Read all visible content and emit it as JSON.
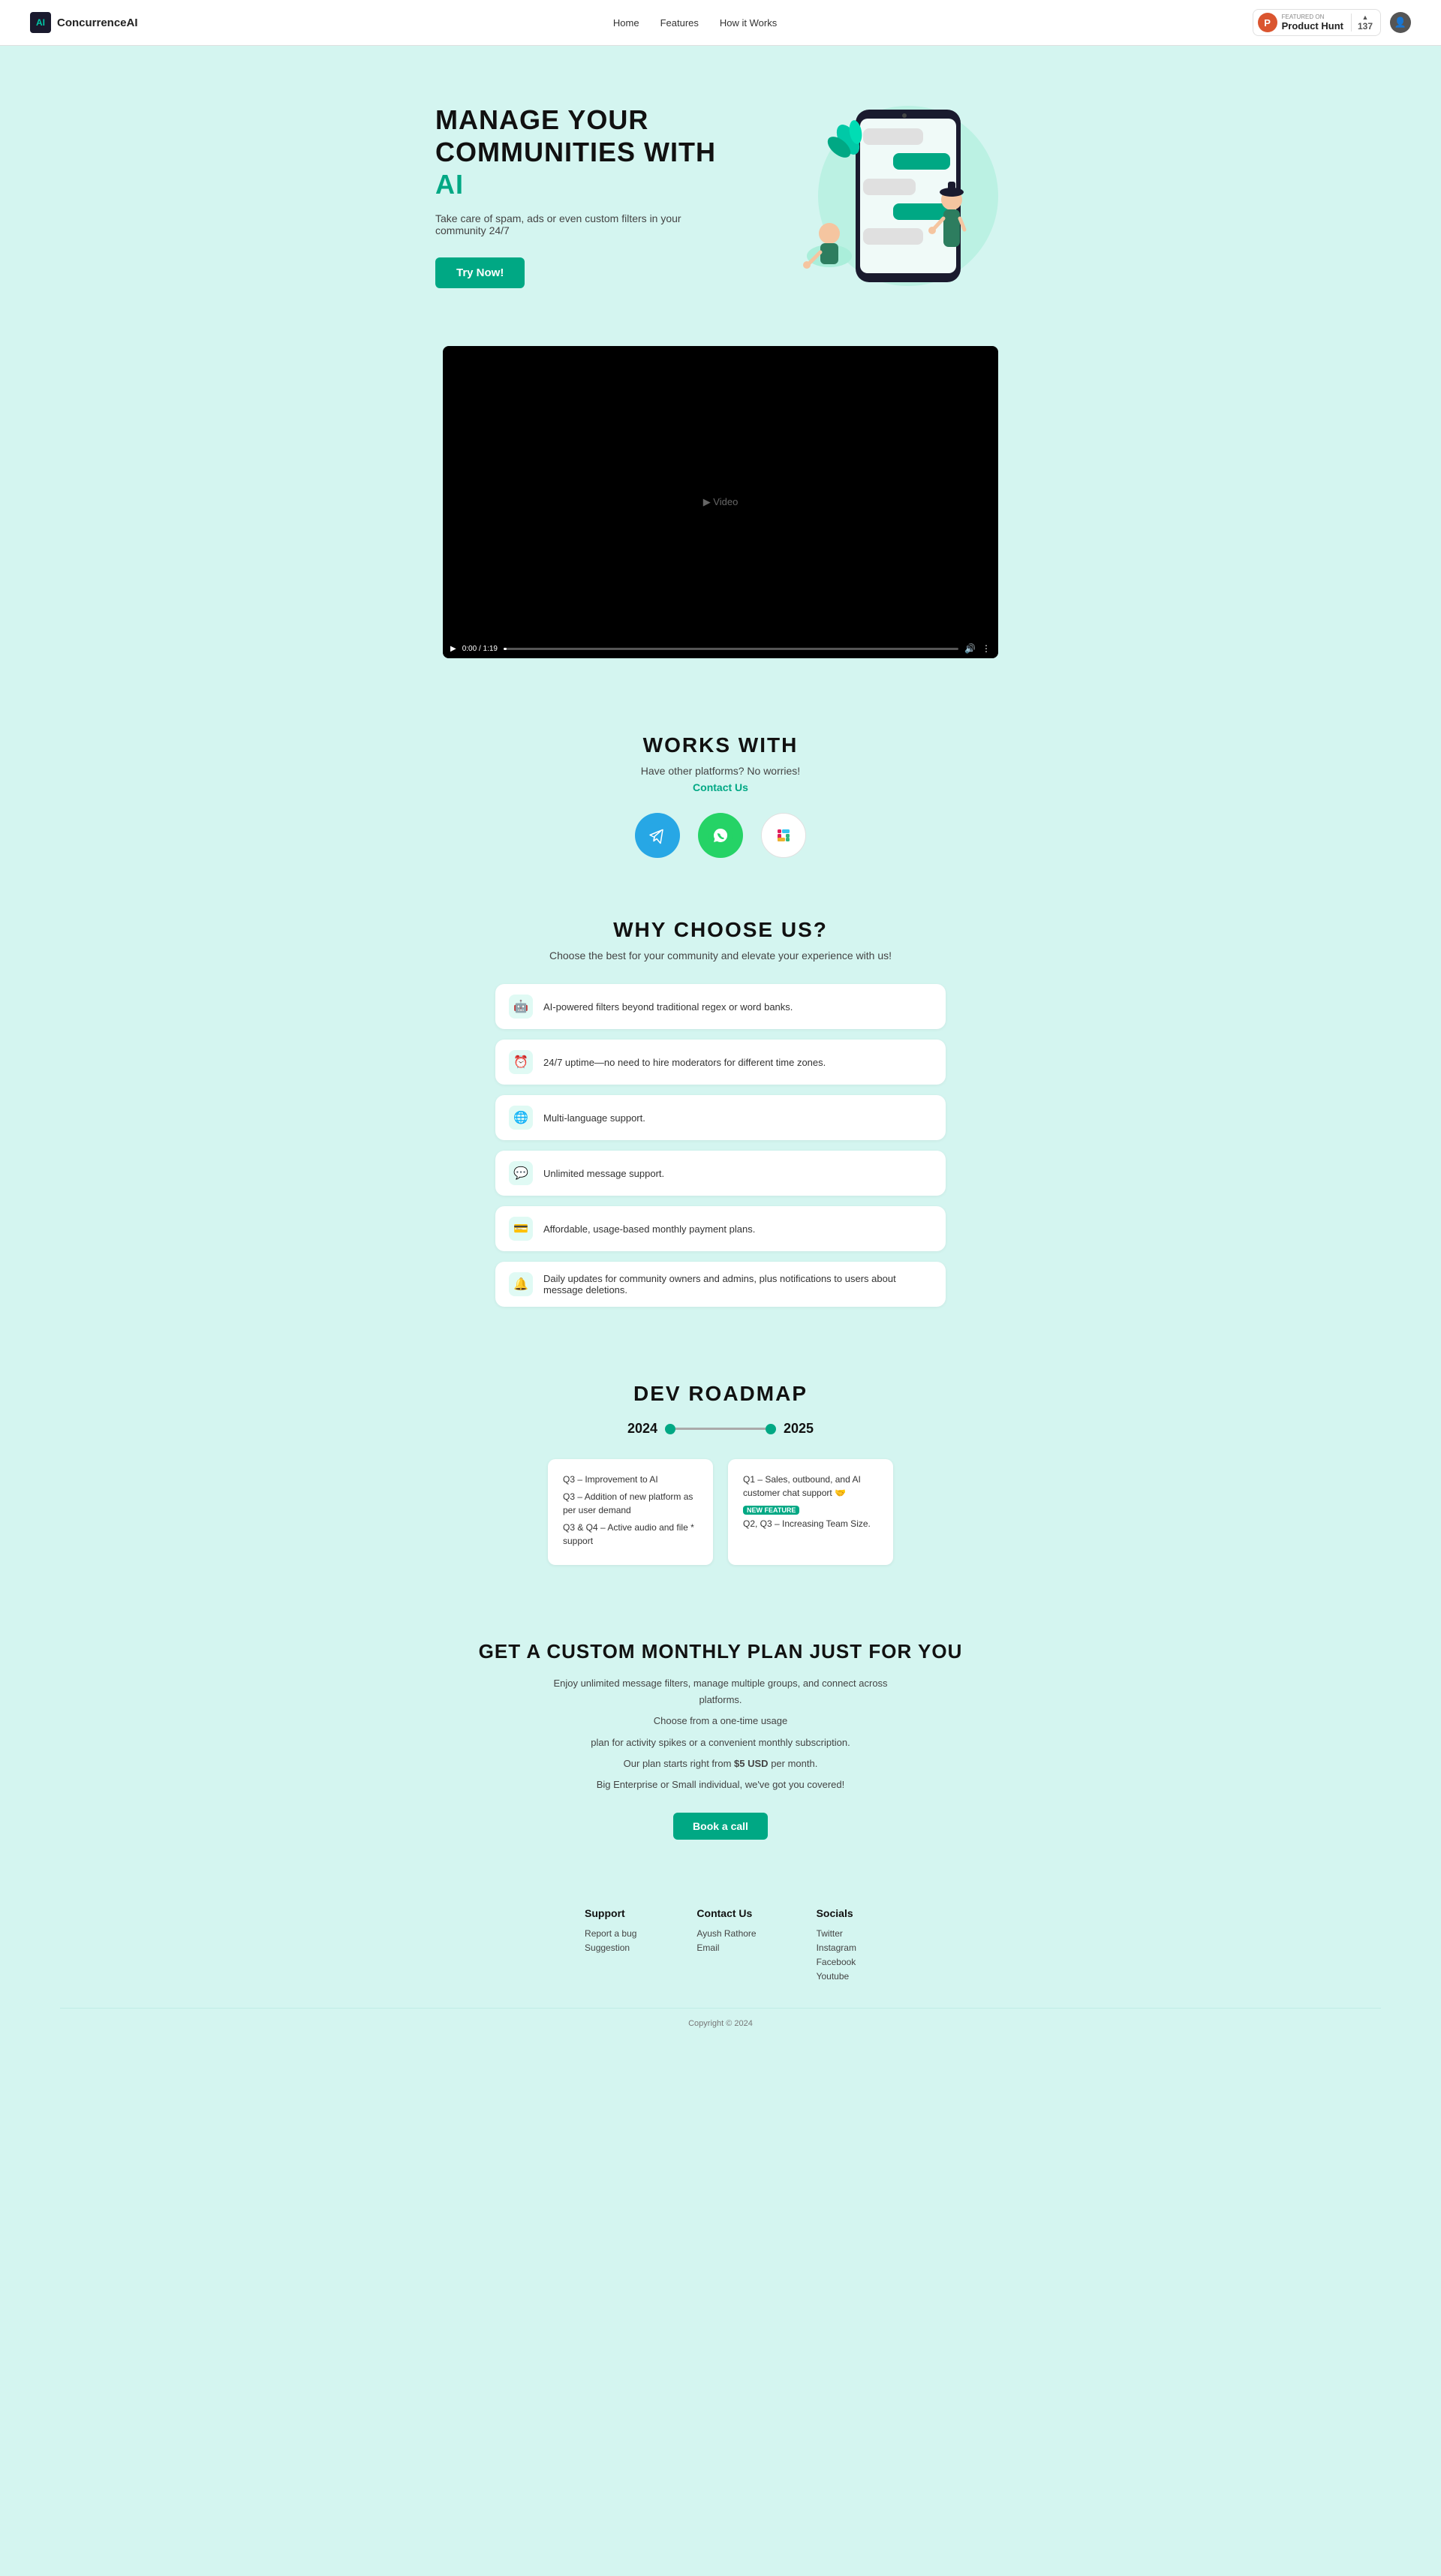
{
  "brand": {
    "logo_text": "ConcurrenceAI",
    "logo_icon": "AI"
  },
  "nav": {
    "links": [
      "Home",
      "Features",
      "How it Works"
    ],
    "product_hunt": {
      "featured_label": "FEATURED ON",
      "name": "Product Hunt",
      "count": "137",
      "arrow": "▲"
    }
  },
  "hero": {
    "title_line1": "MANAGE YOUR COMMUNITIES WITH",
    "title_ai": "AI",
    "subtitle": "Take care of spam, ads or even custom filters in your community 24/7",
    "cta": "Try Now!"
  },
  "video": {
    "time": "0:00 / 1:19"
  },
  "works_with": {
    "title": "WORKS WITH",
    "subtitle": "Have other platforms? No worries!",
    "contact_label": "Contact Us",
    "platforms": [
      {
        "name": "Telegram",
        "icon": "✈",
        "bg": "telegram"
      },
      {
        "name": "WhatsApp",
        "icon": "📱",
        "bg": "whatsapp"
      },
      {
        "name": "Slack",
        "icon": "◈",
        "bg": "slack"
      }
    ]
  },
  "why_choose": {
    "title": "WHY CHOOSE US?",
    "subtitle": "Choose the best for your community and elevate your experience with us!",
    "features": [
      {
        "icon": "🤖",
        "text": "AI-powered filters beyond traditional regex or word banks."
      },
      {
        "icon": "⏰",
        "text": "24/7 uptime—no need to hire moderators for different time zones."
      },
      {
        "icon": "🌐",
        "text": "Multi-language support."
      },
      {
        "icon": "💬",
        "text": "Unlimited message support."
      },
      {
        "icon": "💳",
        "text": "Affordable, usage-based monthly payment plans."
      },
      {
        "icon": "🔔",
        "text": "Daily updates for community owners and admins, plus notifications to users about message deletions."
      }
    ]
  },
  "dev_roadmap": {
    "title": "DEV ROADMAP",
    "year_left": "2024",
    "year_right": "2025",
    "cards": [
      {
        "items": [
          "Q3 – Improvement to AI",
          "Q3 – Addition of new platform as per user demand",
          "Q3 & Q4 – Active audio and file * support"
        ]
      },
      {
        "items": [
          "Q1 – Sales, outbound, and AI customer chat support 🤝",
          "NEW FEATURE",
          "Q2, Q3 – Increasing Team Size."
        ],
        "has_badge": true
      }
    ]
  },
  "custom_plan": {
    "title": "GET A CUSTOM MONTHLY PLAN JUST FOR YOU",
    "desc_lines": [
      "Enjoy unlimited message filters, manage multiple groups, and connect across platforms.",
      "Choose from a one-time usage",
      "plan for activity spikes or a convenient monthly subscription.",
      "Our plan starts right from $5 USD per month.",
      "Big Enterprise or Small individual, we've got you covered!"
    ],
    "price": "$5 USD",
    "cta": "Book a call"
  },
  "footer": {
    "support": {
      "title": "Support",
      "links": [
        "Report a bug",
        "Suggestion"
      ]
    },
    "contact": {
      "title": "Contact Us",
      "items": [
        "Ayush Rathore",
        "Email"
      ]
    },
    "socials": {
      "title": "Socials",
      "links": [
        "Twitter",
        "Instagram",
        "Facebook",
        "Youtube"
      ]
    },
    "copyright": "Copyright © 2024"
  }
}
